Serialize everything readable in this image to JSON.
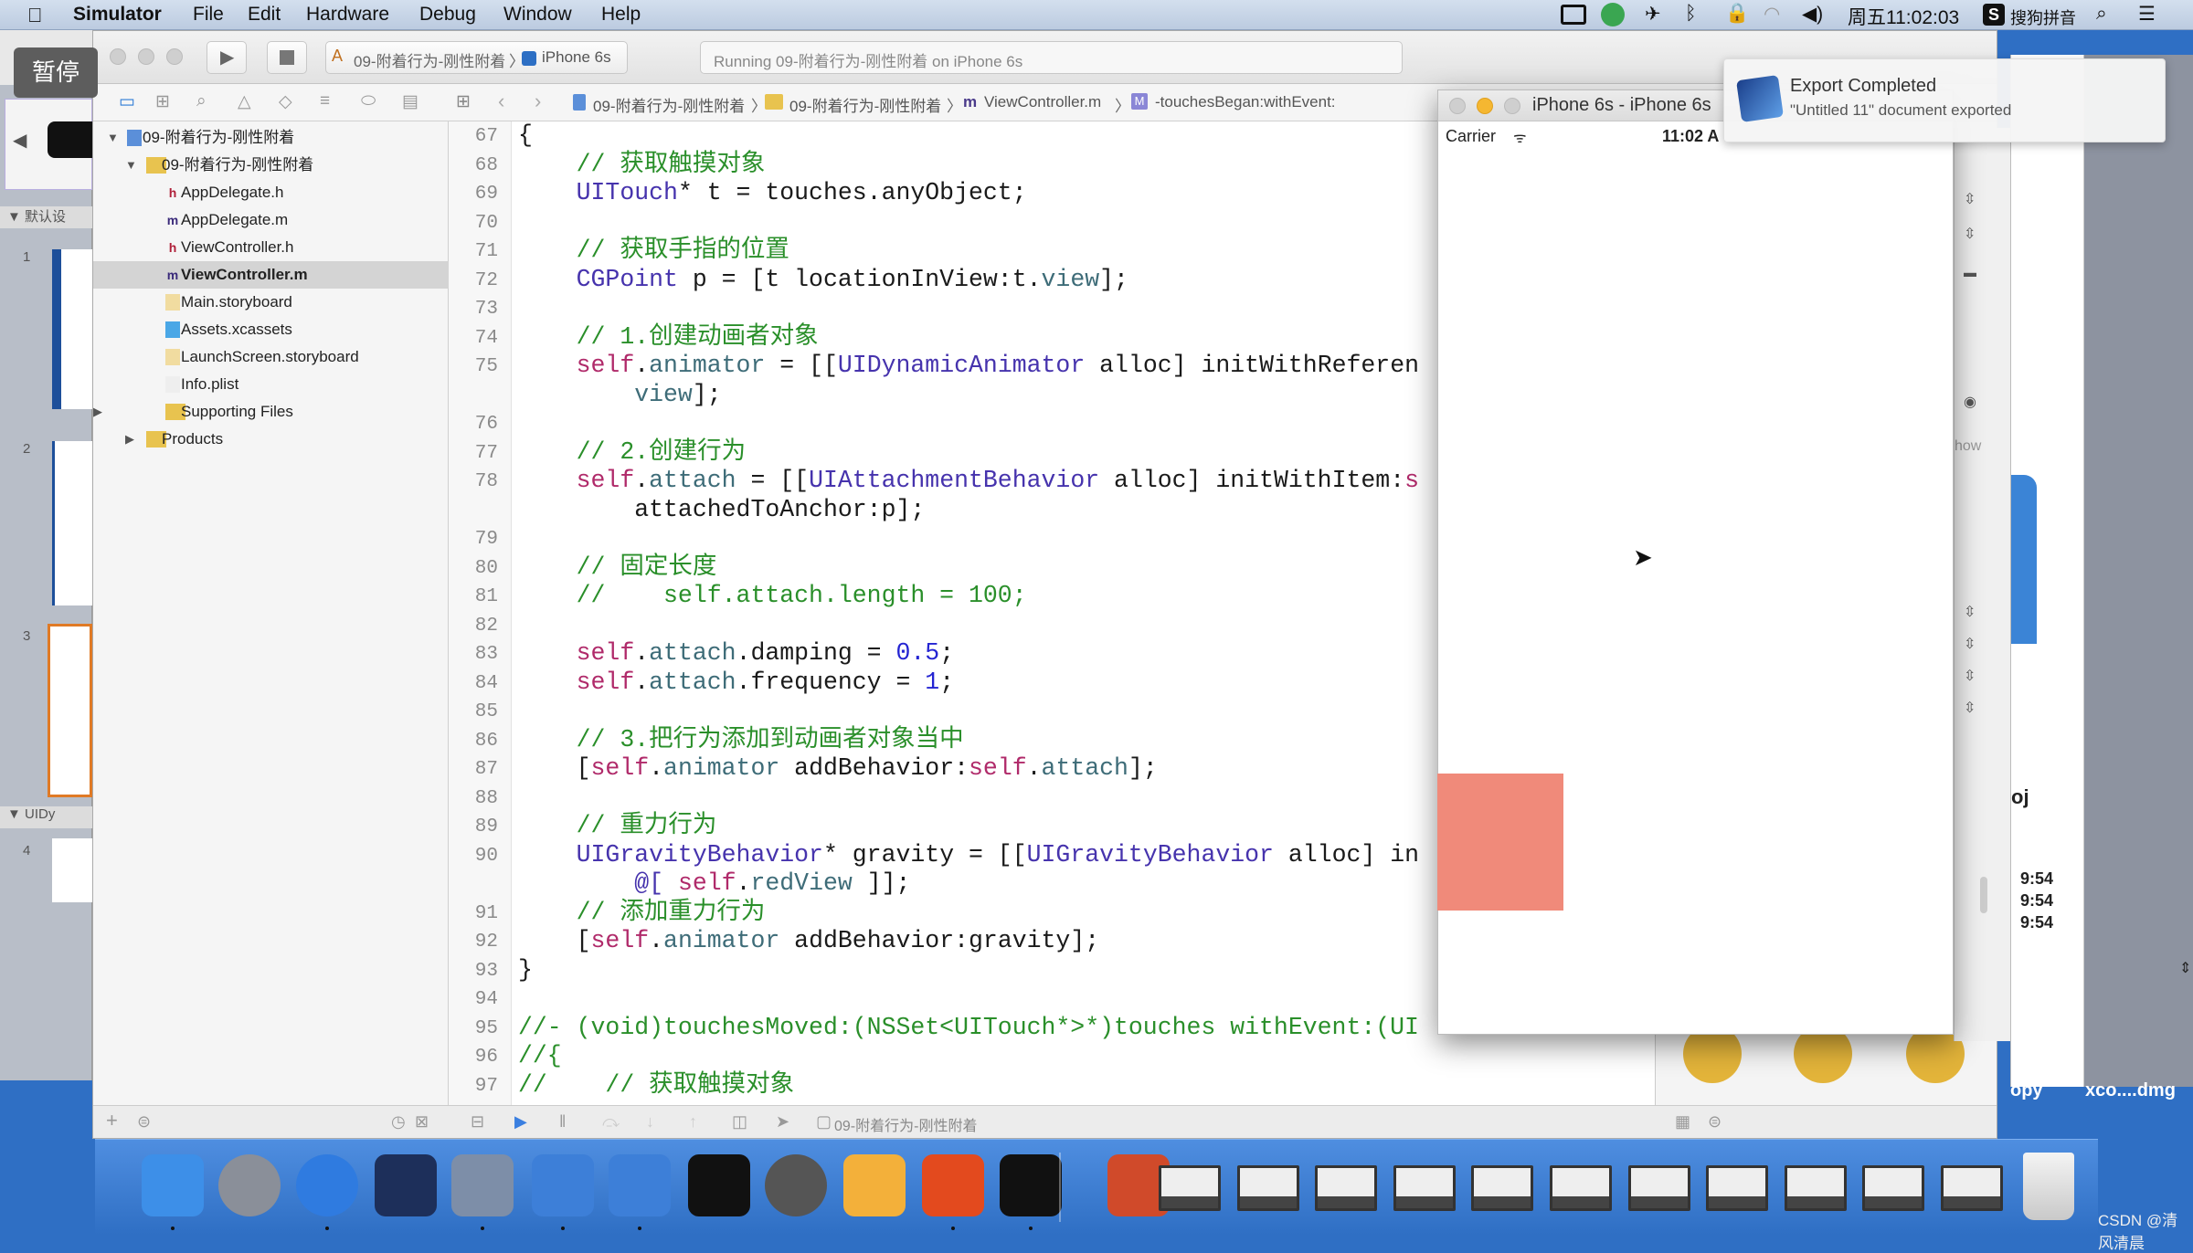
{
  "overlay": {
    "pause_label": "暂停"
  },
  "menubar": {
    "items": [
      "Simulator",
      "File",
      "Edit",
      "Hardware",
      "Debug",
      "Window",
      "Help"
    ],
    "clock": "周五11:02:03",
    "input_method": "搜狗拼音"
  },
  "toolbar": {
    "scheme": "09-附着行为-刚性附着",
    "device": "iPhone 6s",
    "status": "Running 09-附着行为-刚性附着 on iPhone 6s"
  },
  "jumpbar": {
    "project": "09-附着行为-刚性附着",
    "group": "09-附着行为-刚性附着",
    "file": "ViewController.m",
    "method": "-touchesBegan:withEvent:"
  },
  "navigator": {
    "items": [
      {
        "label": "09-附着行为-刚性附着",
        "level": 0,
        "kind": "project",
        "expanded": true
      },
      {
        "label": "09-附着行为-刚性附着",
        "level": 1,
        "kind": "folder",
        "expanded": true
      },
      {
        "label": "AppDelegate.h",
        "level": 2,
        "kind": "h"
      },
      {
        "label": "AppDelegate.m",
        "level": 2,
        "kind": "m"
      },
      {
        "label": "ViewController.h",
        "level": 2,
        "kind": "h"
      },
      {
        "label": "ViewController.m",
        "level": 2,
        "kind": "m",
        "selected": true
      },
      {
        "label": "Main.storyboard",
        "level": 2,
        "kind": "storyboard"
      },
      {
        "label": "Assets.xcassets",
        "level": 2,
        "kind": "assets"
      },
      {
        "label": "LaunchScreen.storyboard",
        "level": 2,
        "kind": "storyboard"
      },
      {
        "label": "Info.plist",
        "level": 2,
        "kind": "plist"
      },
      {
        "label": "Supporting Files",
        "level": 2,
        "kind": "folder",
        "expanded": false
      },
      {
        "label": "Products",
        "level": 1,
        "kind": "folder",
        "expanded": false
      }
    ]
  },
  "editor": {
    "lines": [
      {
        "n": "67",
        "t": [
          [
            "pl",
            "{"
          ]
        ]
      },
      {
        "n": "68",
        "t": [
          [
            "c",
            "    // 获取触摸对象"
          ]
        ]
      },
      {
        "n": "69",
        "t": [
          [
            "ty",
            "    UITouch"
          ],
          [
            "pl",
            "* t = touches.anyObject;"
          ]
        ]
      },
      {
        "n": "70",
        "t": []
      },
      {
        "n": "71",
        "t": [
          [
            "c",
            "    // 获取手指的位置"
          ]
        ]
      },
      {
        "n": "72",
        "t": [
          [
            "ty",
            "    CGPoint"
          ],
          [
            "pl",
            " p = [t locationInView:t."
          ],
          [
            "pr",
            "view"
          ],
          [
            "pl",
            "];"
          ]
        ]
      },
      {
        "n": "73",
        "t": []
      },
      {
        "n": "74",
        "t": [
          [
            "c",
            "    // 1.创建动画者对象"
          ]
        ]
      },
      {
        "n": "75",
        "t": [
          [
            "kw",
            "    self"
          ],
          [
            "pl",
            "."
          ],
          [
            "pr",
            "animator"
          ],
          [
            "pl",
            " = [["
          ],
          [
            "ty",
            "UIDynamicAnimator"
          ],
          [
            "pl",
            " alloc] initWithReferen"
          ]
        ]
      },
      {
        "n": "",
        "t": [
          [
            "pr",
            "        view"
          ],
          [
            "pl",
            "];"
          ]
        ]
      },
      {
        "n": "76",
        "t": []
      },
      {
        "n": "77",
        "t": [
          [
            "c",
            "    // 2.创建行为"
          ]
        ]
      },
      {
        "n": "78",
        "t": [
          [
            "kw",
            "    self"
          ],
          [
            "pl",
            "."
          ],
          [
            "pr",
            "attach"
          ],
          [
            "pl",
            " = [["
          ],
          [
            "ty",
            "UIAttachmentBehavior"
          ],
          [
            "pl",
            " alloc] initWithItem:"
          ],
          [
            "kw",
            "s"
          ]
        ]
      },
      {
        "n": "",
        "t": [
          [
            "pl",
            "        attachedToAnchor:p];"
          ]
        ]
      },
      {
        "n": "79",
        "t": []
      },
      {
        "n": "80",
        "t": [
          [
            "c",
            "    // 固定长度"
          ]
        ]
      },
      {
        "n": "81",
        "t": [
          [
            "c",
            "    //    self.attach.length = 100;"
          ]
        ]
      },
      {
        "n": "82",
        "t": []
      },
      {
        "n": "83",
        "t": [
          [
            "kw",
            "    self"
          ],
          [
            "pl",
            "."
          ],
          [
            "pr",
            "attach"
          ],
          [
            "pl",
            ".damping = "
          ],
          [
            "n",
            "0.5"
          ],
          [
            "pl",
            ";"
          ]
        ]
      },
      {
        "n": "84",
        "t": [
          [
            "kw",
            "    self"
          ],
          [
            "pl",
            "."
          ],
          [
            "pr",
            "attach"
          ],
          [
            "pl",
            ".frequency = "
          ],
          [
            "n",
            "1"
          ],
          [
            "pl",
            ";"
          ]
        ]
      },
      {
        "n": "85",
        "t": []
      },
      {
        "n": "86",
        "t": [
          [
            "c",
            "    // 3.把行为添加到动画者对象当中"
          ]
        ]
      },
      {
        "n": "87",
        "t": [
          [
            "pl",
            "    ["
          ],
          [
            "kw",
            "self"
          ],
          [
            "pl",
            "."
          ],
          [
            "pr",
            "animator"
          ],
          [
            "pl",
            " addBehavior:"
          ],
          [
            "kw",
            "self"
          ],
          [
            "pl",
            "."
          ],
          [
            "pr",
            "attach"
          ],
          [
            "pl",
            "];"
          ]
        ]
      },
      {
        "n": "88",
        "t": []
      },
      {
        "n": "89",
        "t": [
          [
            "c",
            "    // 重力行为"
          ]
        ]
      },
      {
        "n": "90",
        "t": [
          [
            "ty",
            "    UIGravityBehavior"
          ],
          [
            "pl",
            "* gravity = [["
          ],
          [
            "ty",
            "UIGravityBehavior"
          ],
          [
            "pl",
            " alloc] in"
          ]
        ]
      },
      {
        "n": "",
        "t": [
          [
            "ty",
            "        @[ "
          ],
          [
            "kw",
            "self"
          ],
          [
            "pl",
            "."
          ],
          [
            "pr",
            "redView"
          ],
          [
            "pl",
            " ]];"
          ]
        ]
      },
      {
        "n": "91",
        "t": [
          [
            "c",
            "    // 添加重力行为"
          ]
        ]
      },
      {
        "n": "92",
        "t": [
          [
            "pl",
            "    ["
          ],
          [
            "kw",
            "self"
          ],
          [
            "pl",
            "."
          ],
          [
            "pr",
            "animator"
          ],
          [
            "pl",
            " addBehavior:gravity];"
          ]
        ]
      },
      {
        "n": "93",
        "t": [
          [
            "pl",
            "}"
          ]
        ]
      },
      {
        "n": "94",
        "t": []
      },
      {
        "n": "95",
        "t": [
          [
            "c",
            "//- (void)touchesMoved:(NSSet<UITouch*>*)touches withEvent:(UI"
          ]
        ]
      },
      {
        "n": "96",
        "t": [
          [
            "c",
            "//{"
          ]
        ]
      },
      {
        "n": "97",
        "t": [
          [
            "c",
            "//    // 获取触摸对象"
          ]
        ]
      }
    ],
    "bottom_target": "09-附着行为-刚性附着"
  },
  "simulator": {
    "title": "iPhone 6s - iPhone 6s",
    "carrier": "Carrier",
    "time": "11:02 A",
    "red_view_color": "#f08a7a"
  },
  "notification": {
    "title": "Export Completed",
    "body": "\"Untitled 11\" document exported"
  },
  "left_window": {
    "section1": "▼ 默认设",
    "section2": "▼ UIDy",
    "numbers": [
      "1",
      "2",
      "3",
      "4"
    ]
  },
  "right_window": {
    "partial_text": "oj",
    "times": [
      "9:54",
      "9:54",
      "9:54"
    ],
    "inspector_button": "how"
  },
  "desktop": {
    "file1": "opy",
    "file2": "xco....dmg"
  },
  "dock": {
    "apps": [
      "finder",
      "launchpad",
      "safari",
      "mouse-app",
      "photo-slideshow",
      "xcode",
      "xcode-beta",
      "terminal",
      "system-preferences",
      "sketch",
      "p-app",
      "console",
      "preview-app"
    ],
    "documents": 11
  },
  "watermark": "CSDN @清风清晨",
  "colors": {
    "accent": "#3b7fe0",
    "comment": "#2a8f2a",
    "keyword": "#b02a6a",
    "red_view": "#f08a7a"
  }
}
